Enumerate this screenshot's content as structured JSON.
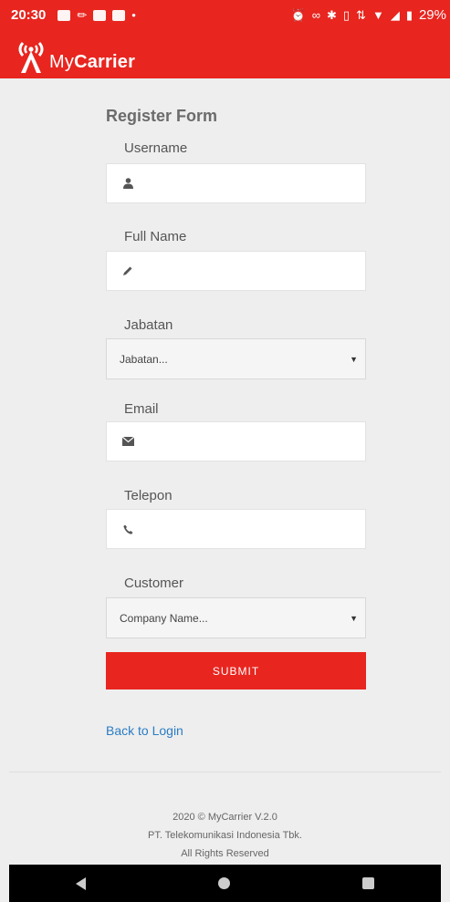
{
  "status_bar": {
    "time": "20:30",
    "battery": "29%"
  },
  "app": {
    "brand_prefix": "My",
    "brand_suffix": "Carrier"
  },
  "form": {
    "title": "Register Form",
    "username_label": "Username",
    "fullname_label": "Full Name",
    "jabatan_label": "Jabatan",
    "jabatan_selected": "Jabatan...",
    "email_label": "Email",
    "telepon_label": "Telepon",
    "customer_label": "Customer",
    "customer_selected": "Company Name...",
    "submit_label": "SUBMIT",
    "back_link": "Back to Login"
  },
  "footer": {
    "line1": "2020 © MyCarrier V.2.0",
    "line2": "PT. Telekomunikasi Indonesia Tbk.",
    "line3": "All Rights Reserved"
  },
  "colors": {
    "brand_red": "#e8251f",
    "link_blue": "#2a7dc4",
    "background": "#eeeeee"
  },
  "icons": {
    "username": "user-icon",
    "fullname": "pencil-icon",
    "email": "envelope-icon",
    "telepon": "phone-icon"
  }
}
